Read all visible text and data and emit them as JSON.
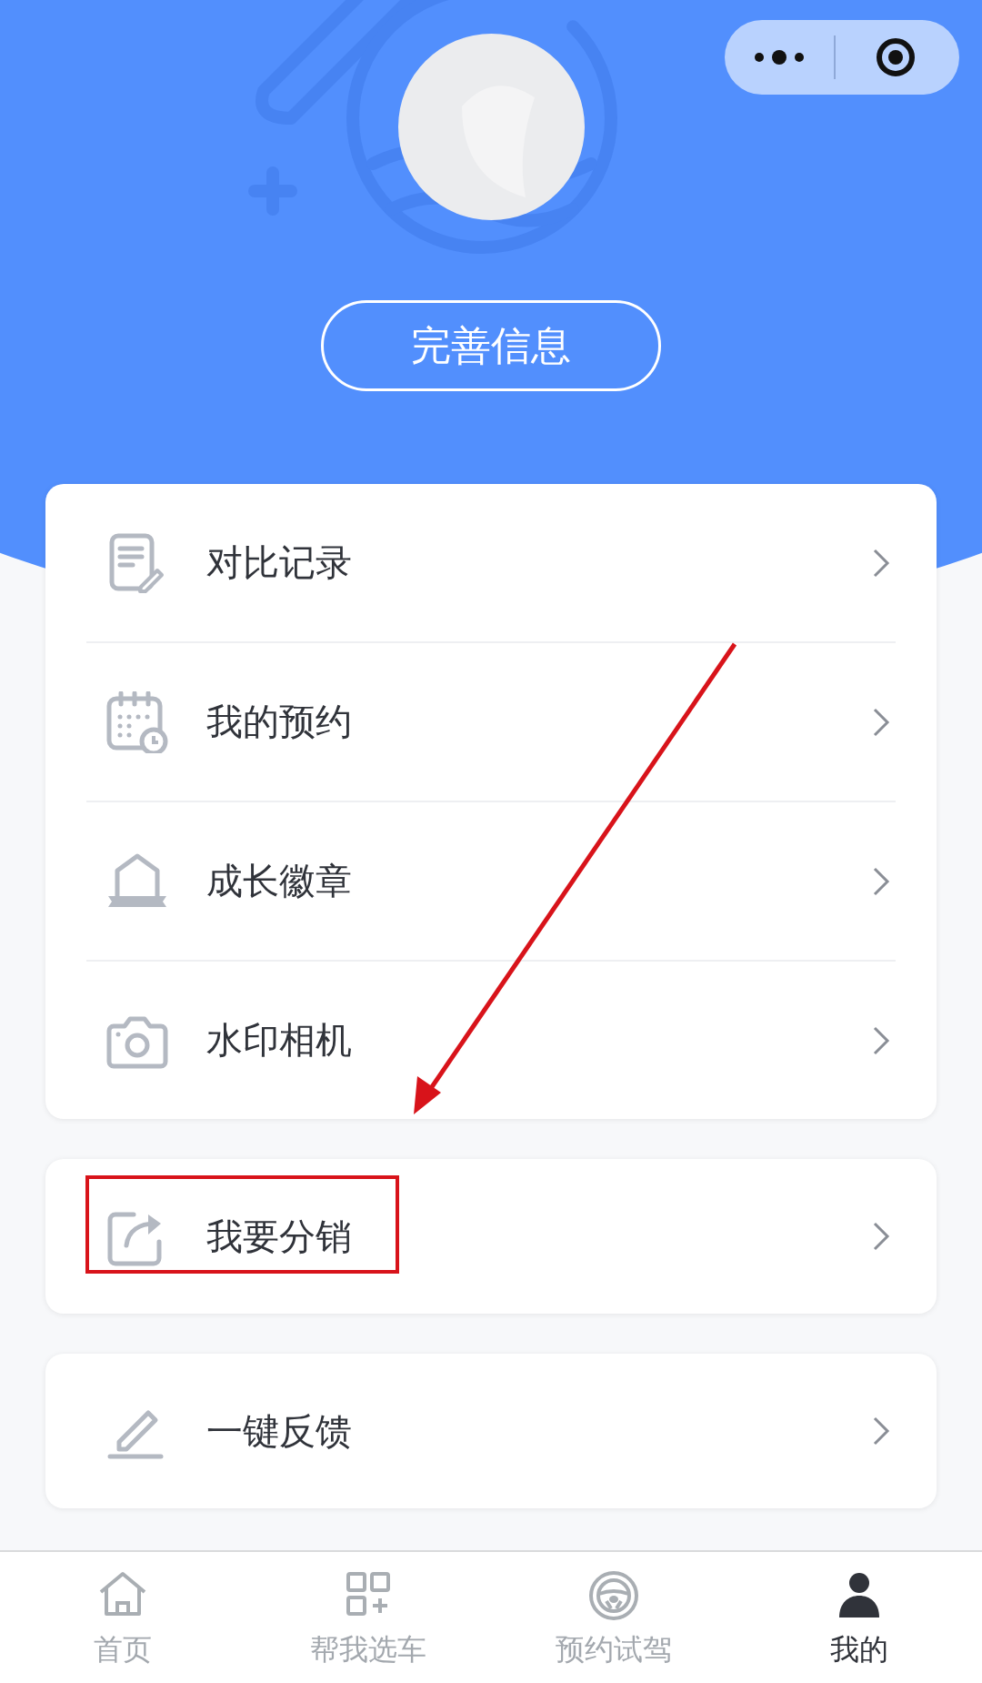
{
  "profile": {
    "button": "完善信息"
  },
  "menu_groups": [
    {
      "items": [
        {
          "label": "对比记录",
          "highlighted": false
        },
        {
          "label": "我的预约",
          "highlighted": false
        },
        {
          "label": "成长徽章",
          "highlighted": false
        },
        {
          "label": "水印相机",
          "highlighted": false
        }
      ]
    },
    {
      "items": [
        {
          "label": "我要分销",
          "highlighted": true
        }
      ]
    },
    {
      "items": [
        {
          "label": "一键反馈",
          "highlighted": false
        }
      ]
    }
  ],
  "tab_bar": [
    {
      "label": "首页",
      "selected": false
    },
    {
      "label": "帮我选车",
      "selected": false
    },
    {
      "label": "预约试驾",
      "selected": false
    },
    {
      "label": "我的",
      "selected": true
    }
  ]
}
